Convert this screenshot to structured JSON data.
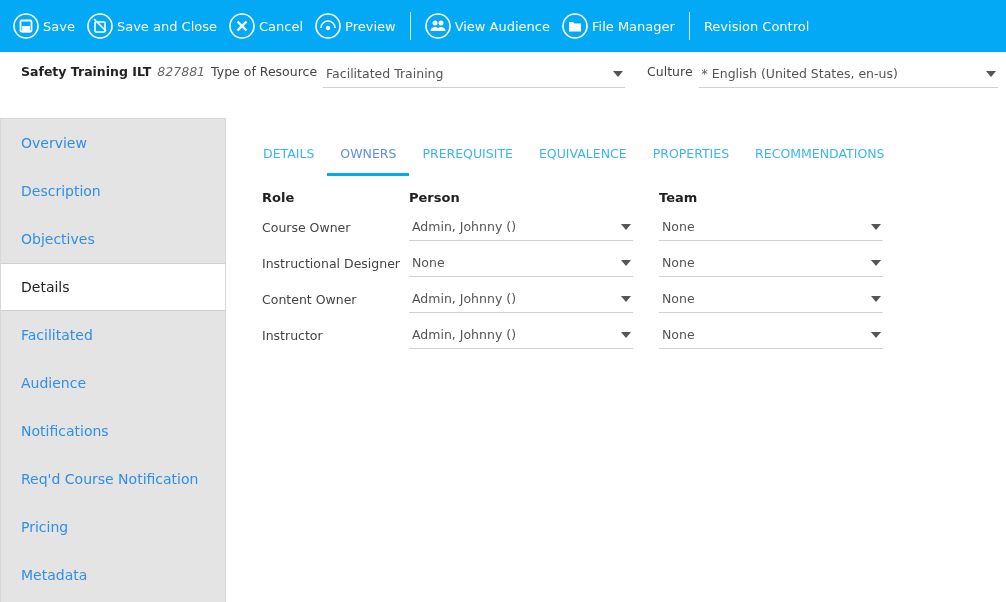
{
  "toolbar": [
    {
      "kind": "save",
      "label": "Save"
    },
    {
      "kind": "save-close",
      "label": "Save and Close"
    },
    {
      "kind": "cancel",
      "label": "Cancel"
    },
    {
      "kind": "preview",
      "label": "Preview",
      "divider_after": true
    },
    {
      "kind": "audience",
      "label": "View Audience"
    },
    {
      "kind": "folder",
      "label": "File Manager",
      "divider_after": true
    },
    {
      "kind": "text",
      "label": "Revision Control"
    }
  ],
  "header": {
    "title": "Safety Training ILT",
    "code": "827881",
    "type_label": "Type of Resource",
    "type_value": "Facilitated Training",
    "culture_label": "Culture",
    "culture_value": "* English (United States, en-us)"
  },
  "sidebar": {
    "items": [
      {
        "label": "Overview",
        "selected": false
      },
      {
        "label": "Description",
        "selected": false
      },
      {
        "label": "Objectives",
        "selected": false
      },
      {
        "label": "Details",
        "selected": true
      },
      {
        "label": "Facilitated",
        "selected": false
      },
      {
        "label": "Audience",
        "selected": false
      },
      {
        "label": "Notifications",
        "selected": false
      },
      {
        "label": "Req'd Course Notification",
        "selected": false
      },
      {
        "label": "Pricing",
        "selected": false
      },
      {
        "label": "Metadata",
        "selected": false
      }
    ]
  },
  "tabs": [
    {
      "label": "DETAILS",
      "selected": false
    },
    {
      "label": "OWNERS",
      "selected": true
    },
    {
      "label": "PREREQUISITE",
      "selected": false
    },
    {
      "label": "EQUIVALENCE",
      "selected": false
    },
    {
      "label": "PROPERTIES",
      "selected": false
    },
    {
      "label": "RECOMMENDATIONS",
      "selected": false
    }
  ],
  "owners": {
    "columns": [
      "Role",
      "Person",
      "Team"
    ],
    "rows": [
      {
        "role": "Course Owner",
        "person": "Admin, Johnny ()",
        "team": "None"
      },
      {
        "role": "Instructional Designer",
        "person": "None",
        "team": "None"
      },
      {
        "role": "Content Owner",
        "person": "Admin, Johnny ()",
        "team": "None"
      },
      {
        "role": "Instructor",
        "person": "Admin, Johnny ()",
        "team": "None"
      }
    ]
  }
}
